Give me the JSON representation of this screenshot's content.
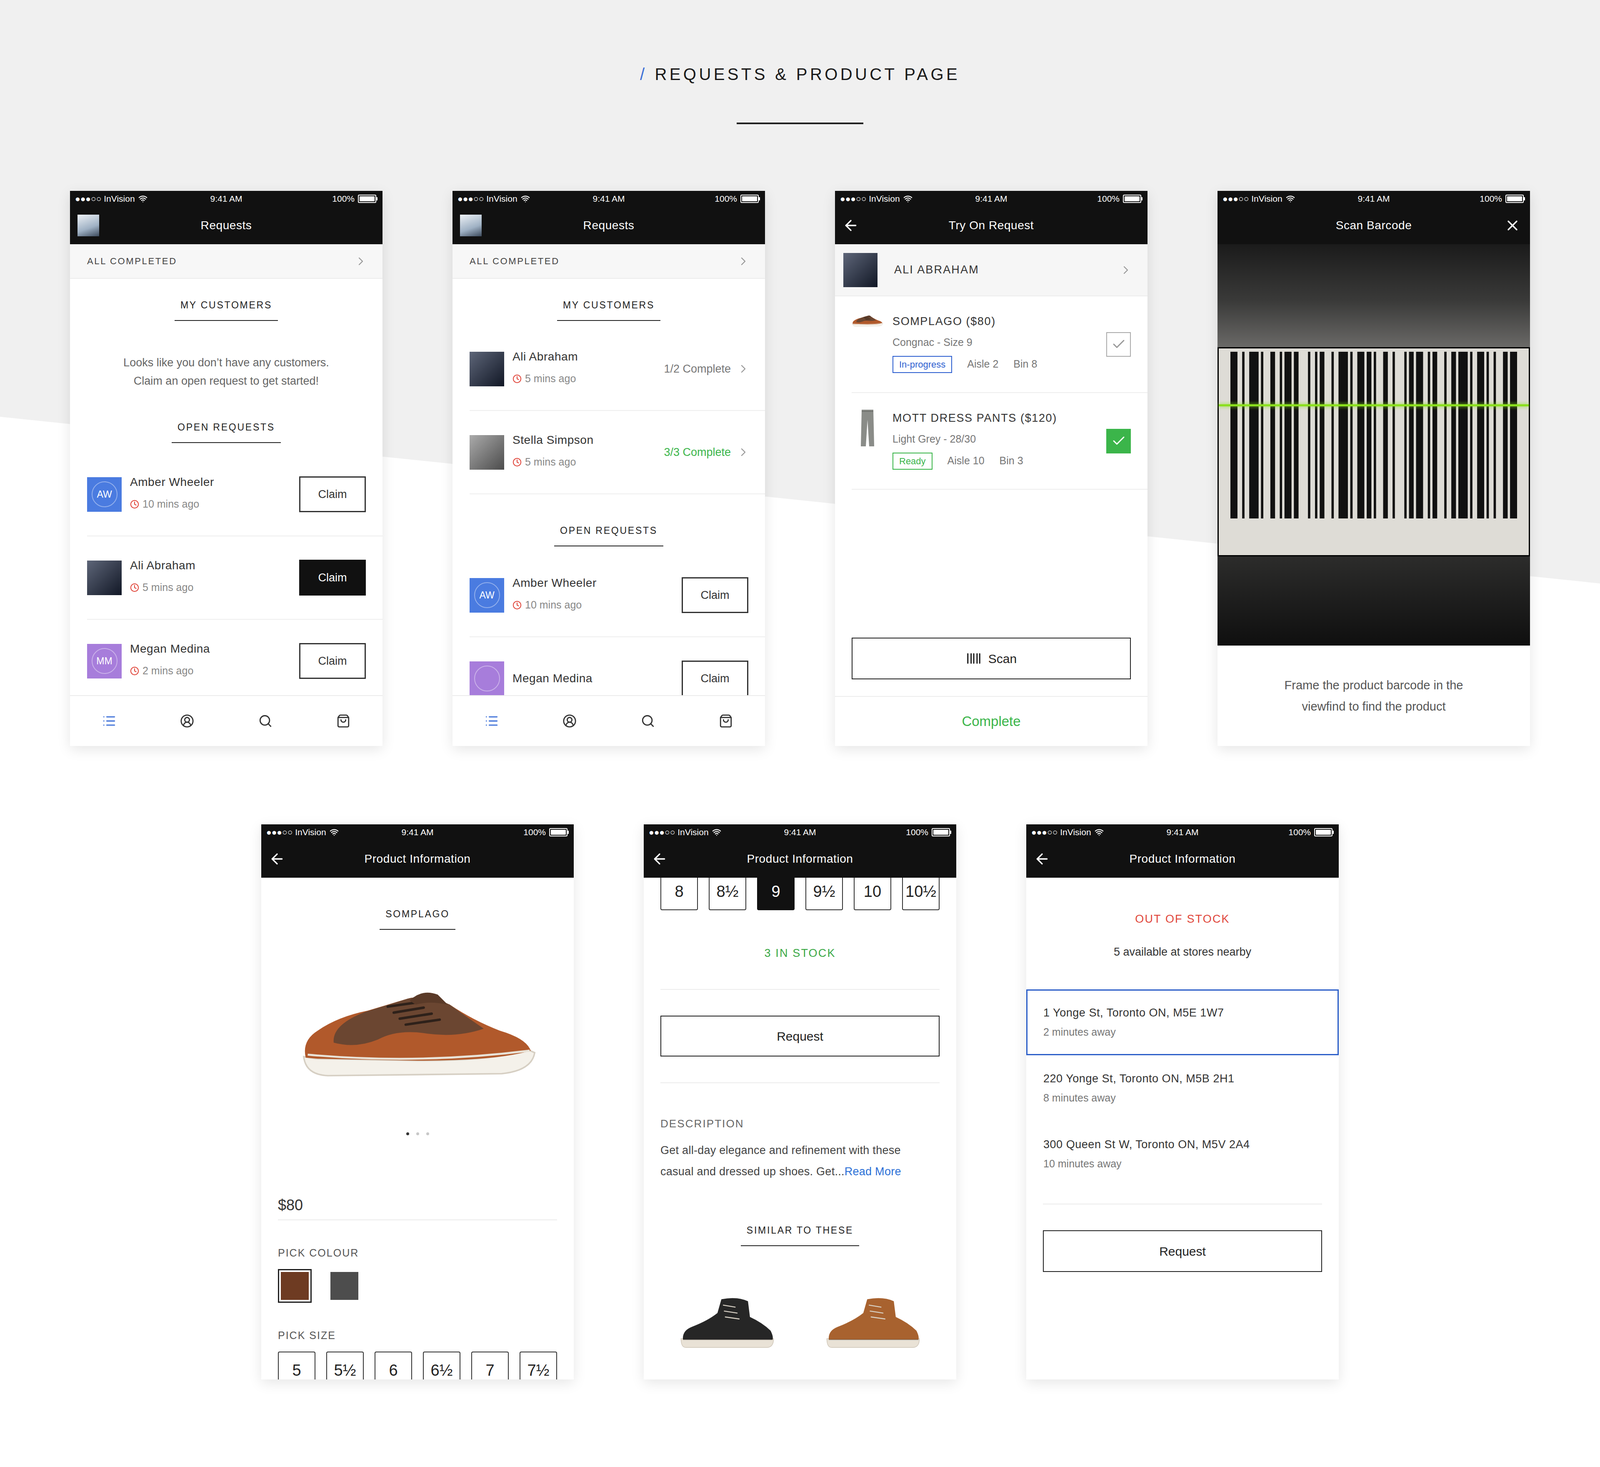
{
  "header": {
    "slash": "/",
    "title": "REQUESTS & PRODUCT PAGE"
  },
  "status_bar": {
    "carrier": "●●●○○ InVision",
    "time": "9:41 AM",
    "battery": "100%"
  },
  "screens": {
    "requests_empty": {
      "title": "Requests",
      "all_completed": "ALL COMPLETED",
      "my_customers_title": "MY CUSTOMERS",
      "empty_message": [
        "Looks like you don’t have any customers.",
        "Claim an open request to get started!"
      ],
      "open_requests_title": "OPEN REQUESTS",
      "open_requests": [
        {
          "name": "Amber Wheeler",
          "avatar": "initials",
          "initials": "AW",
          "color": "#4a7be0",
          "time": "10 mins ago",
          "button": "Claim",
          "selected": false
        },
        {
          "name": "Ali Abraham",
          "avatar": "photo",
          "color": "#1f2a44",
          "time": "5 mins ago",
          "button": "Claim",
          "selected": true
        },
        {
          "name": "Megan Medina",
          "avatar": "initials",
          "initials": "MM",
          "color": "#a77ddb",
          "time": "2 mins ago",
          "button": "Claim",
          "selected": false
        }
      ],
      "tab_bar": [
        {
          "selected": true
        },
        {
          "selected": false
        },
        {
          "selected": false
        },
        {
          "selected": false
        }
      ]
    },
    "requests_active": {
      "title": "Requests",
      "all_completed": "ALL COMPLETED",
      "my_customers_title": "MY CUSTOMERS",
      "customers": [
        {
          "name": "Ali Abraham",
          "avatar": "photo",
          "color": "#1f2a44",
          "time": "5 mins ago",
          "progress": "1/2 Complete",
          "complete": false
        },
        {
          "name": "Stella Simpson",
          "avatar": "photo",
          "color": "#8a8a8a",
          "time": "5 mins ago",
          "progress": "3/3 Complete",
          "complete": true
        }
      ],
      "open_requests_title": "OPEN REQUESTS",
      "open_requests": [
        {
          "name": "Amber Wheeler",
          "avatar": "initials",
          "initials": "AW",
          "color": "#4a7be0",
          "time": "10 mins ago",
          "button": "Claim",
          "selected": false
        },
        {
          "name": "Megan Medina",
          "avatar": "initials",
          "color": "#a77ddb",
          "button": "Claim",
          "selected": false
        }
      ],
      "tab_bar": [
        {
          "selected": true
        },
        {
          "selected": false
        },
        {
          "selected": false
        },
        {
          "selected": false
        }
      ]
    },
    "try_on_request": {
      "title": "Try On Request",
      "customer": {
        "name": "ALI ABRAHAM",
        "avatar": "photo",
        "color": "#1f2a44"
      },
      "items": [
        {
          "name": "SOMPLAGO ($80)",
          "variant": "Congnac - Size 9",
          "status": "In-progress",
          "color": "#2d5fd0",
          "aisle": "Aisle 2",
          "bin": "Bin 8",
          "checked": false,
          "kind": "shoe"
        },
        {
          "name": "MOTT DRESS PANTS ($120)",
          "variant": "Light Grey - 28/30",
          "status": "Ready",
          "color": "#3bb54a",
          "aisle": "Aisle 10",
          "bin": "Bin 3",
          "checked": true,
          "kind": "pants"
        }
      ],
      "scan_button": "Scan",
      "complete_button": "Complete"
    },
    "scan_barcode": {
      "title": "Scan Barcode",
      "instruction": [
        "Frame the product barcode in the",
        "viewfind to find the product"
      ]
    },
    "product_top": {
      "title": "Product Information",
      "name": "SOMPLAGO",
      "carousel": [
        {
          "selected": true
        },
        {
          "selected": false
        },
        {
          "selected": false
        }
      ],
      "price": "$80",
      "colour_label": "PICK COLOUR",
      "colours": [
        {
          "color": "#6e3b22",
          "selected": true
        },
        {
          "color": "#4d4d4d",
          "selected": false
        }
      ],
      "size_label": "PICK SIZE",
      "sizes": [
        {
          "label": "5",
          "selected": false
        },
        {
          "label": "5½",
          "selected": false
        },
        {
          "label": "6",
          "selected": false
        },
        {
          "label": "6½",
          "selected": false
        },
        {
          "label": "7",
          "selected": false
        },
        {
          "label": "7½",
          "selected": false
        }
      ]
    },
    "product_middle": {
      "title": "Product Information",
      "sizes": [
        {
          "label": "8",
          "selected": false
        },
        {
          "label": "8½",
          "selected": false
        },
        {
          "label": "9",
          "selected": true
        },
        {
          "label": "9½",
          "selected": false
        },
        {
          "label": "10",
          "selected": false
        },
        {
          "label": "10½",
          "selected": false
        }
      ],
      "stock": "3 IN STOCK",
      "request_button": "Request",
      "description_label": "DESCRIPTION",
      "description": [
        "Get all-day elegance and refinement with these",
        "casual and dressed up shoes. Get..."
      ],
      "read_more": "Read More",
      "similar_title": "SIMILAR TO THESE",
      "similar": [
        {
          "color": "#262626"
        },
        {
          "color": "#a8622f"
        }
      ]
    },
    "product_out_of_stock": {
      "title": "Product Information",
      "status": "OUT OF STOCK",
      "availability": "5 available at stores nearby",
      "stores": [
        {
          "address": "1 Yonge St, Toronto ON, M5E 1W7",
          "distance": "2 minutes away",
          "selected": true
        },
        {
          "address": "220 Yonge St, Toronto ON, M5B 2H1",
          "distance": "8 minutes away",
          "selected": false
        },
        {
          "address": "300 Queen St W, Toronto ON, M5V 2A4",
          "distance": "10 minutes away",
          "selected": false
        }
      ],
      "request_button": "Request"
    }
  }
}
